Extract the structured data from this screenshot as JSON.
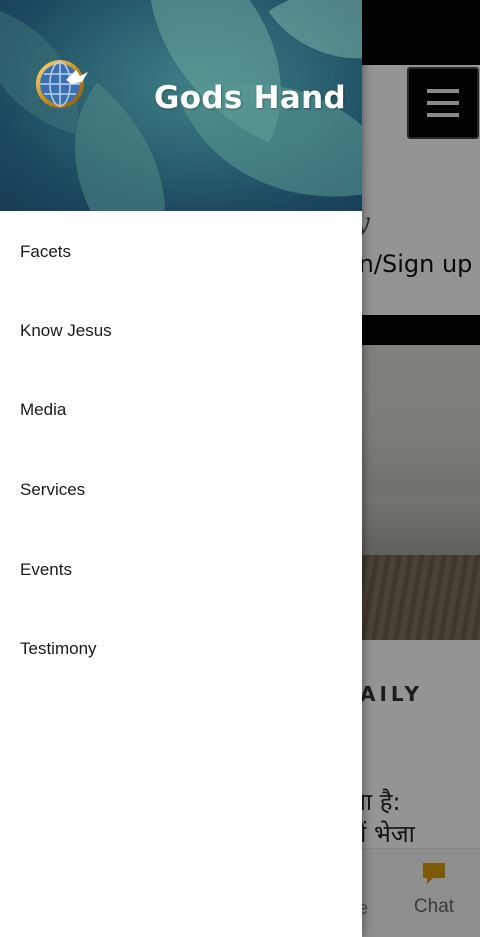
{
  "drawer": {
    "brand_title": "Gods Hand",
    "menu_items": [
      {
        "label": "Facets"
      },
      {
        "label": "Know Jesus"
      },
      {
        "label": "Media"
      },
      {
        "label": "Services"
      },
      {
        "label": "Events"
      },
      {
        "label": "Testimony"
      }
    ]
  },
  "background": {
    "signature_mark": "y",
    "login_link": "in/Sign up",
    "daily_heading": "AILY",
    "verse_line1": "या है:",
    "verse_line2": "में भेजा",
    "bottom_nav": {
      "partial_label": "e",
      "chat_label": "Chat",
      "chat_icon": "chat-bubble-icon"
    }
  },
  "colors": {
    "chat_accent": "#d99a0c",
    "drawer_header": "#1f4f66",
    "scrim": "rgba(0,0,0,0.42)"
  }
}
